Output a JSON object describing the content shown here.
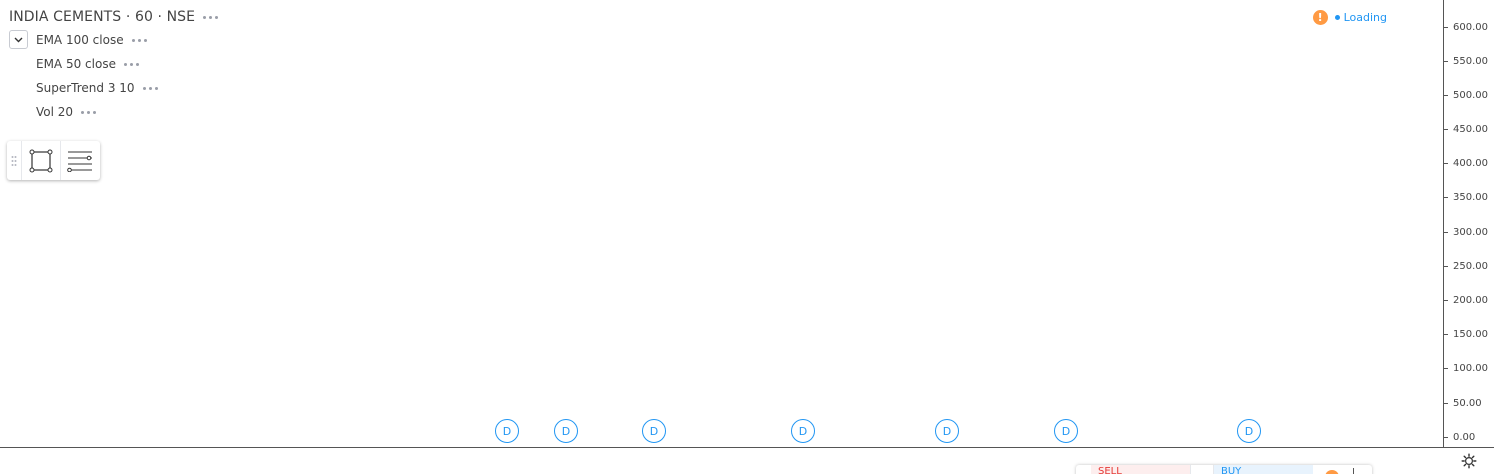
{
  "legend": {
    "symbol": "INDIA CEMENTS · 60 · NSE",
    "indicators": [
      {
        "label": "EMA 100 close"
      },
      {
        "label": "EMA 50 close"
      },
      {
        "label": "SuperTrend 3 10"
      },
      {
        "label": "Vol 20"
      }
    ]
  },
  "status": {
    "warning_glyph": "!",
    "text": "Loading"
  },
  "price_scale": {
    "ticks": [
      "600.00",
      "550.00",
      "500.00",
      "450.00",
      "400.00",
      "350.00",
      "300.00",
      "250.00",
      "200.00",
      "150.00",
      "100.00",
      "50.00",
      "0.00"
    ]
  },
  "markers": {
    "label": "D",
    "count": 7
  },
  "trade_panel": {
    "sell_label": "SELL",
    "buy_label": "BUY"
  },
  "colors": {
    "accent": "#2196f3",
    "warning": "#ff9a43",
    "sell": "#e53935"
  },
  "icons": {
    "toolbar": [
      "drag-grip-icon",
      "rectangle-icon",
      "fib-levels-icon"
    ],
    "corner": "settings-gear-icon"
  }
}
